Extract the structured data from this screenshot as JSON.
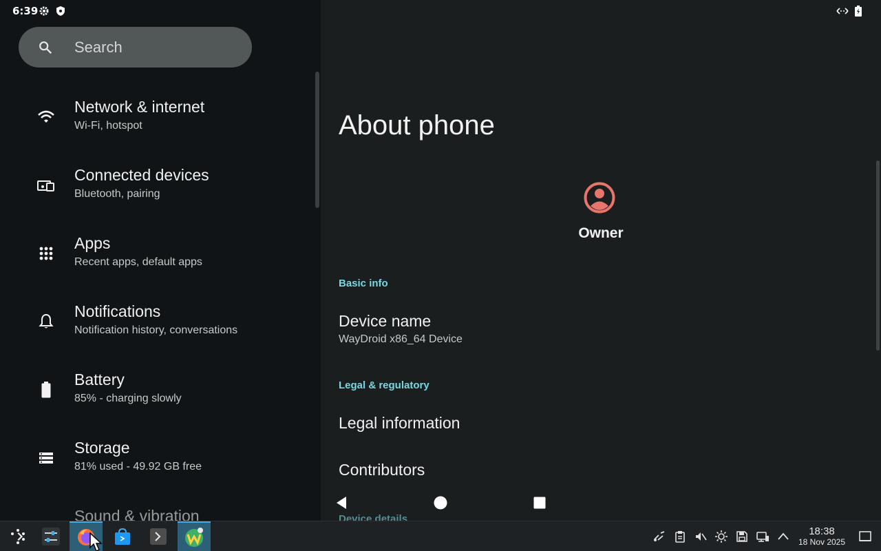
{
  "statusbar": {
    "time": "6:39"
  },
  "sidebar": {
    "search_placeholder": "Search",
    "items": [
      {
        "title": "Network & internet",
        "subtitle": "Wi-Fi, hotspot",
        "icon": "wifi-icon"
      },
      {
        "title": "Connected devices",
        "subtitle": "Bluetooth, pairing",
        "icon": "devices-icon"
      },
      {
        "title": "Apps",
        "subtitle": "Recent apps, default apps",
        "icon": "apps-grid-icon"
      },
      {
        "title": "Notifications",
        "subtitle": "Notification history, conversations",
        "icon": "bell-icon"
      },
      {
        "title": "Battery",
        "subtitle": "85% - charging slowly",
        "icon": "battery-icon"
      },
      {
        "title": "Storage",
        "subtitle": "81% used - 49.92 GB free",
        "icon": "storage-icon"
      },
      {
        "title": "Sound & vibration",
        "subtitle": "",
        "icon": "volume-icon"
      }
    ]
  },
  "main": {
    "title": "About phone",
    "owner": "Owner",
    "sections": {
      "basic_info": "Basic info",
      "legal": "Legal & regulatory",
      "device_details": "Device details"
    },
    "device_name": {
      "title": "Device name",
      "value": "WayDroid x86_64 Device"
    },
    "legal_information": "Legal information",
    "contributors": "Contributors"
  },
  "taskbar": {
    "apps": [
      "launcher",
      "settings-mixer",
      "firefox",
      "store",
      "terminal",
      "waydroid"
    ],
    "clock_time": "18:38",
    "clock_date": "18 Nov 2025"
  },
  "colors": {
    "accent": "#7ad7e2",
    "avatar": "#e8756b",
    "left_bg": "#101416",
    "right_bg": "#1b1e1f"
  }
}
